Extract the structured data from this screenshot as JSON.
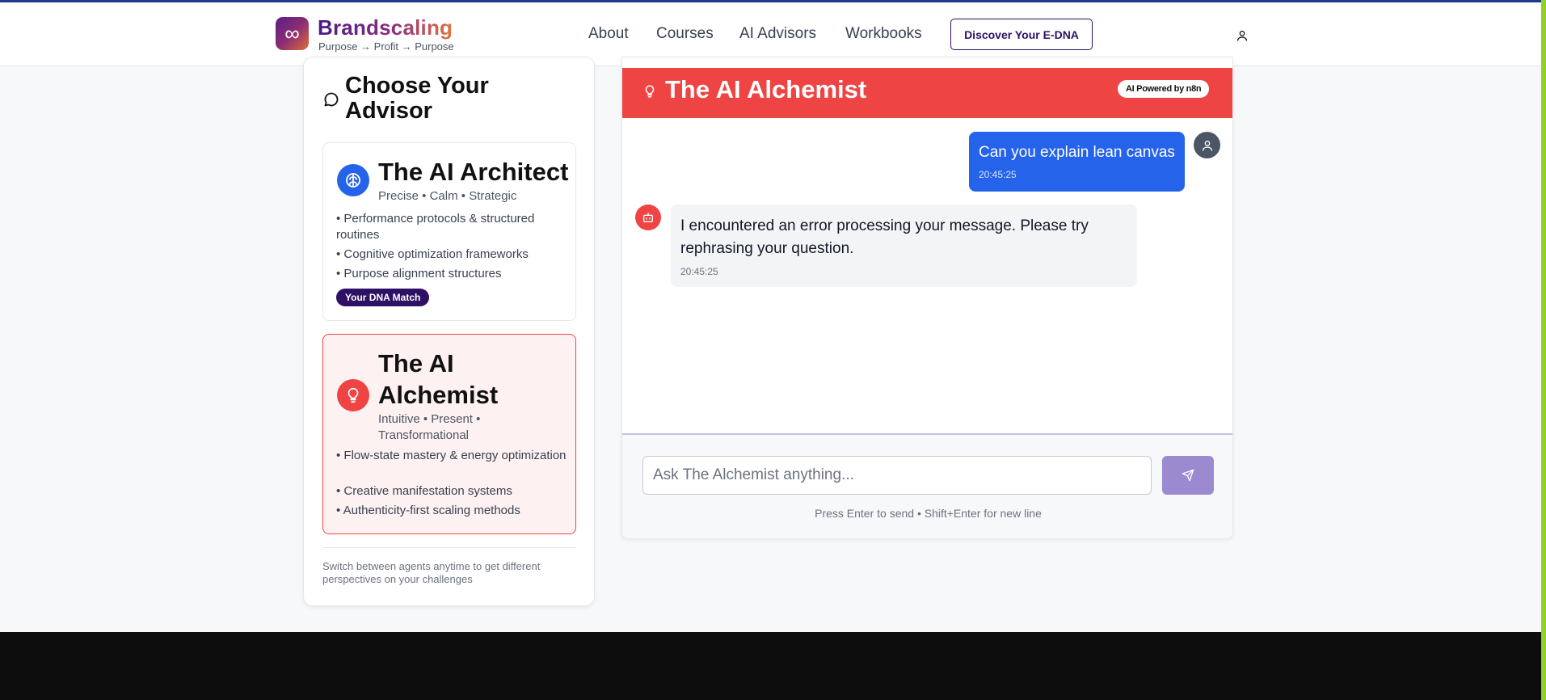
{
  "brand": {
    "name": "Brandscaling",
    "tagline": "Purpose → Profit → Purpose",
    "logo_icon": "infinity-icon",
    "logo_glyph": "∞"
  },
  "nav": {
    "items": [
      "About",
      "Courses",
      "AI Advisors",
      "Workbooks"
    ],
    "cta": "Discover Your E-DNA",
    "user_icon": "user-icon"
  },
  "sidebar": {
    "title": "Choose Your Advisor",
    "advisors": [
      {
        "name": "The AI Architect",
        "traits": "Precise • Calm • Strategic",
        "icon": "brain-icon",
        "features": [
          "• Performance protocols & structured routines",
          "• Cognitive optimization frameworks",
          "• Purpose alignment structures"
        ],
        "badge": "Your DNA Match"
      },
      {
        "name": "The AI Alchemist",
        "traits": "Intuitive • Present • Transformational",
        "icon": "lightbulb-icon",
        "features": [
          "• Flow-state mastery & energy optimization",
          "• Creative manifestation systems",
          "• Authenticity-first scaling methods"
        ]
      }
    ],
    "footer_note": "Switch between agents anytime to get different perspectives on your challenges"
  },
  "chat": {
    "title": "The AI Alchemist",
    "powered_badge": "AI Powered by n8n",
    "messages": [
      {
        "role": "user",
        "text": "Can you explain lean canvas",
        "time": "20:45:25"
      },
      {
        "role": "bot",
        "text": "I encountered an error processing your message. Please try rephrasing your question.",
        "time": "20:45:25"
      }
    ],
    "input_placeholder": "Ask The Alchemist anything...",
    "hint": "Press Enter to send • Shift+Enter for new line"
  },
  "colors": {
    "alchemist_red": "#ef4444",
    "architect_blue": "#2563eb",
    "brand_purple": "#2e1065",
    "send_button": "#9b8ad0"
  }
}
